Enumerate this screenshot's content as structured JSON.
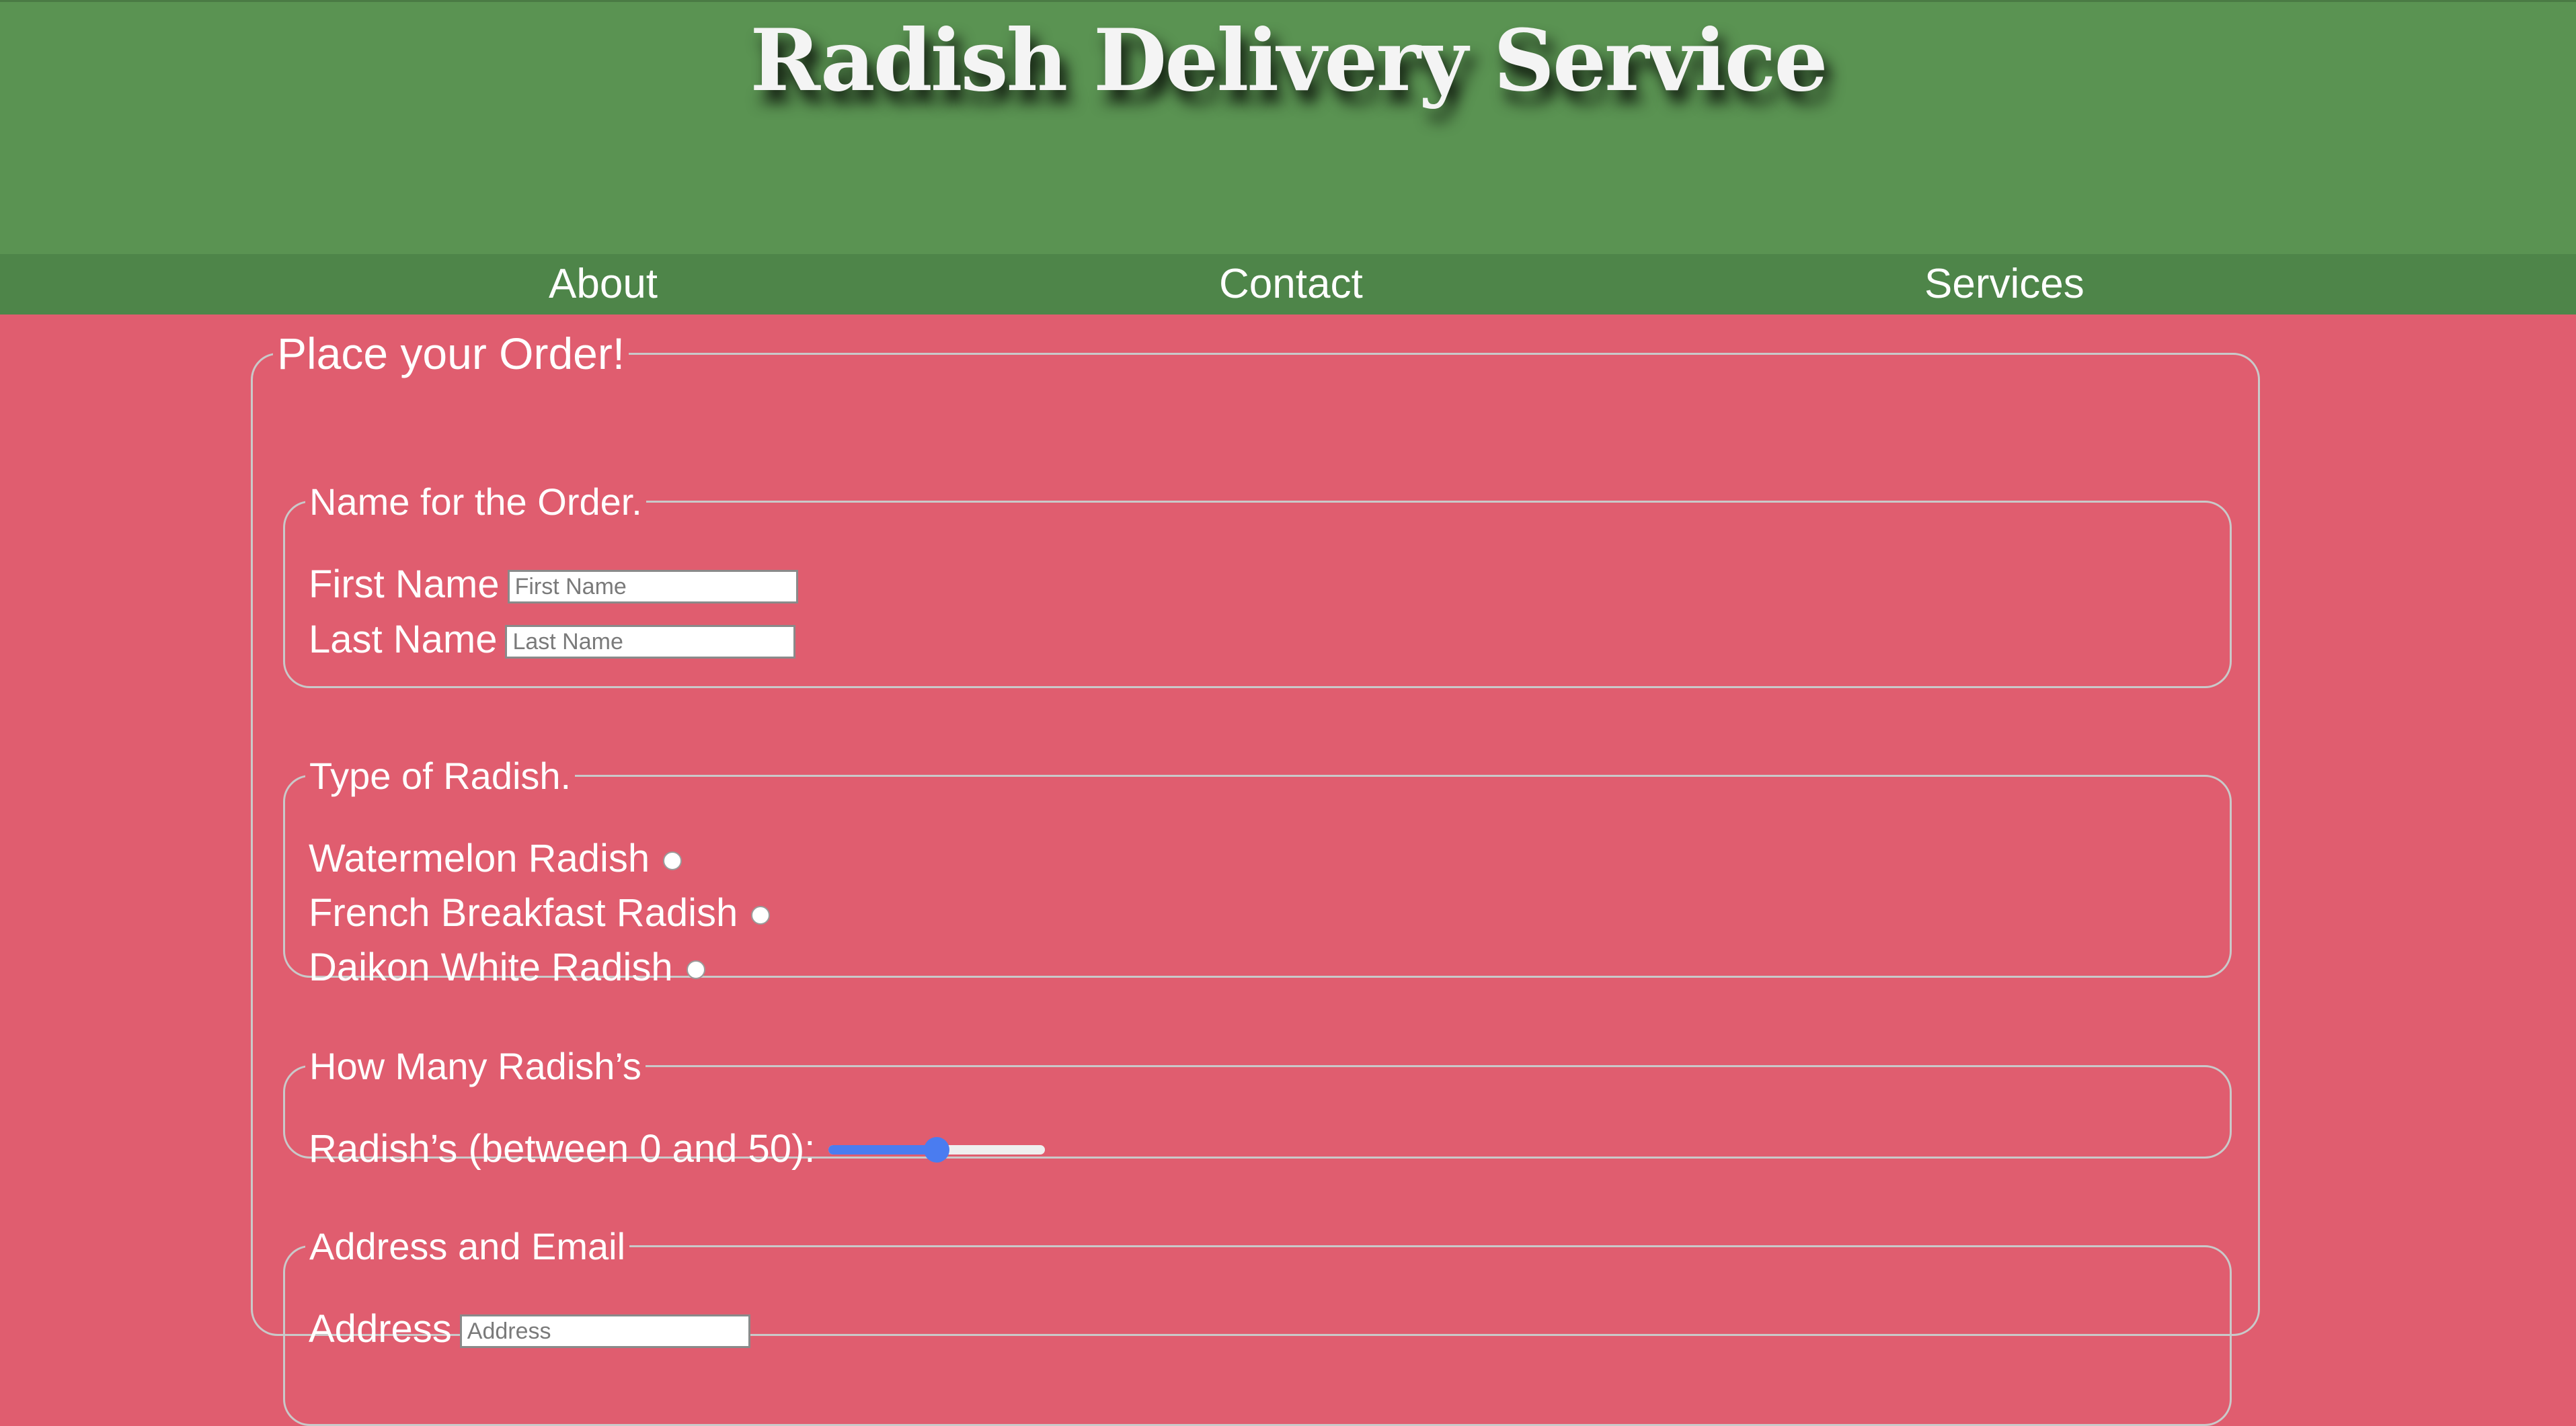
{
  "header": {
    "title": "Radish Delivery Service"
  },
  "nav": {
    "items": [
      {
        "label": "About"
      },
      {
        "label": "Contact"
      },
      {
        "label": "Services"
      }
    ]
  },
  "form": {
    "legend": "Place your Order!",
    "name_section": {
      "legend": "Name for the Order.",
      "first_name_label": "First Name",
      "first_name_placeholder": "First Name",
      "first_name_value": "",
      "last_name_label": "Last Name",
      "last_name_placeholder": "Last Name",
      "last_name_value": ""
    },
    "type_section": {
      "legend": "Type of Radish.",
      "options": [
        {
          "label": "Watermelon Radish",
          "selected": false
        },
        {
          "label": "French Breakfast Radish",
          "selected": false
        },
        {
          "label": "Daikon White Radish",
          "selected": false
        }
      ]
    },
    "count_section": {
      "legend": "How Many Radish’s",
      "slider_label": "Radish’s (between 0 and 50):",
      "slider_min": 0,
      "slider_max": 50,
      "slider_value": 25
    },
    "address_section": {
      "legend": "Address and Email",
      "address_label": "Address",
      "address_placeholder": "Address"
    }
  },
  "colors": {
    "page_background": "#e05d6f",
    "header_background": "#5a9352",
    "nav_background": "#4e8549",
    "slider_accent": "#4a7cf0"
  }
}
